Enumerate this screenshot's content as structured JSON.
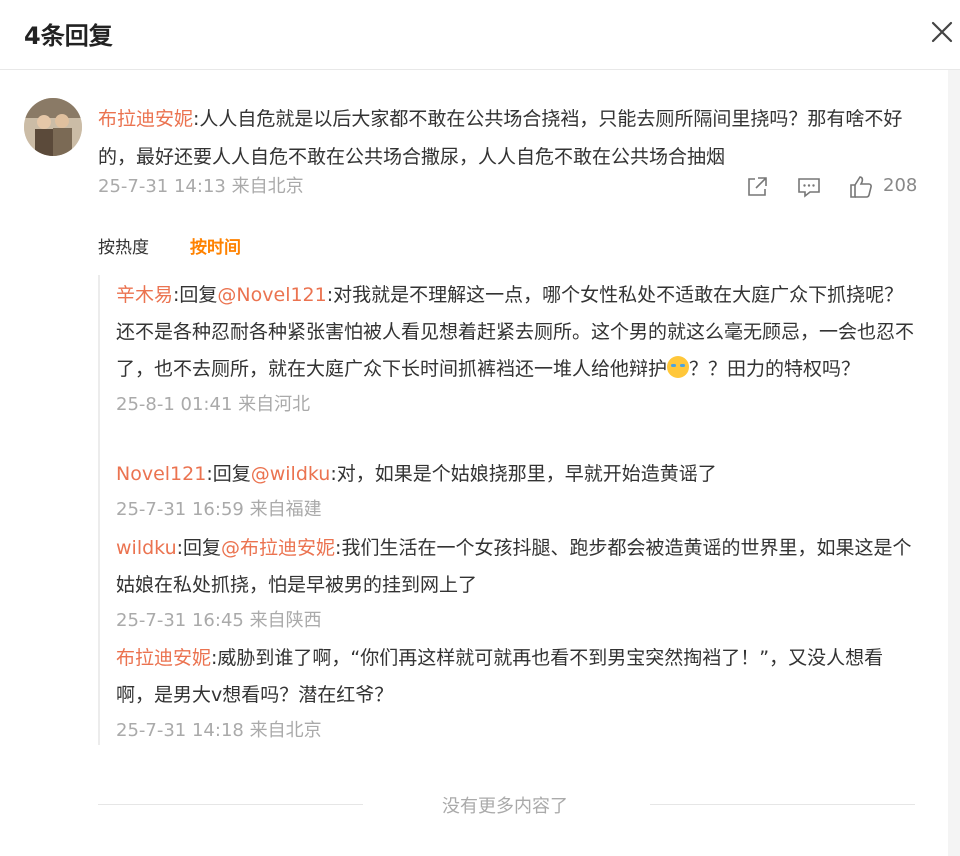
{
  "header": {
    "title": "4条回复"
  },
  "main_comment": {
    "author": "布拉迪安妮",
    "text": ":人人自危就是以后大家都不敢在公共场合挠裆，只能去厕所隔间里挠吗？那有啥不好的，最好还要人人自危不敢在公共场合撒尿，人人自危不敢在公共场合抽烟",
    "meta": "25-7-31 14:13 来自北京",
    "likes": "208"
  },
  "sort": {
    "hot": "按热度",
    "time": "按时间"
  },
  "replies": [
    {
      "author": "辛木易",
      "reply_prefix": ":回复",
      "mention": "@Novel121",
      "text": ":对我就是不理解这一点，哪个女性私处不适敢在大庭广众下抓挠呢？还不是各种忍耐各种紧张害怕被人看见想着赶紧去厕所。这个男的就这么毫无顾忌，一会也忍不了，也不去厕所，就在大庭广众下长时间抓裤裆还一堆人给他辩护",
      "text_tail": "？？田力的特权吗？",
      "meta": "25-8-1 01:41 来自河北"
    },
    {
      "author": "Novel121",
      "reply_prefix": ":回复",
      "mention": "@wildku",
      "text": ":对，如果是个姑娘挠那里，早就开始造黄谣了",
      "meta": "25-7-31 16:59 来自福建"
    },
    {
      "author": "wildku",
      "reply_prefix": ":回复",
      "mention": "@布拉迪安妮",
      "text": ":我们生活在一个女孩抖腿、跑步都会被造黄谣的世界里，如果这是个姑娘在私处抓挠，怕是早被男的挂到网上了",
      "meta": "25-7-31 16:45 来自陕西"
    },
    {
      "author": "布拉迪安妮",
      "text": ":威胁到谁了啊，“你们再这样就可就再也看不到男宝突然掏裆了！”，又没人想看啊，是男大v想看吗？潜在红爷？",
      "meta": "25-7-31 14:18 来自北京"
    }
  ],
  "footer": {
    "no_more": "没有更多内容了"
  },
  "colors": {
    "accent": "#eb7350",
    "sort_active": "#ff8200",
    "meta": "#aaaaaa"
  },
  "icons": [
    "close-icon",
    "share-icon",
    "comment-icon",
    "like-icon",
    "emoji-icon"
  ]
}
